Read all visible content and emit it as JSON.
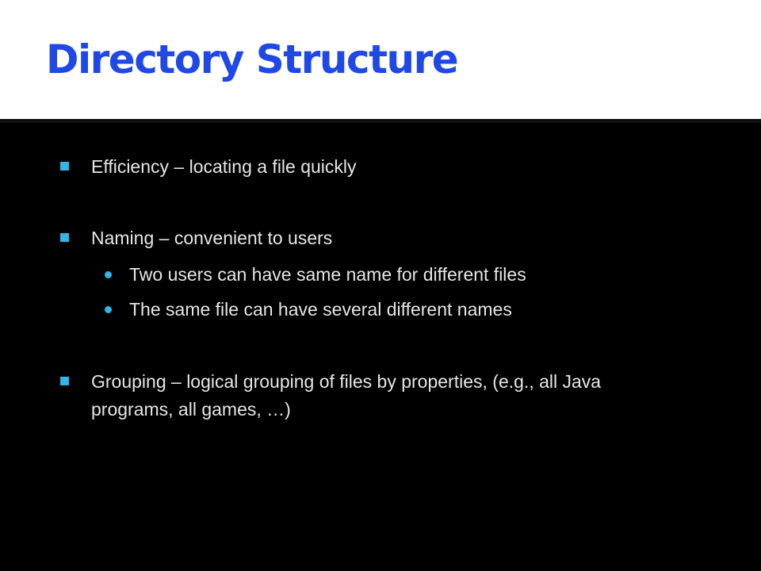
{
  "slide": {
    "title": "Directory Structure",
    "bullets": [
      {
        "text": "Efficiency – locating a file quickly",
        "subitems": []
      },
      {
        "text": "Naming – convenient to users",
        "subitems": [
          "Two users can have same name for different files",
          "The same file can have several different names"
        ]
      },
      {
        "text_line1": "Grouping – logical grouping of files by properties, (e.g., all Java",
        "text_line2": "programs, all games, …)"
      }
    ]
  },
  "colors": {
    "title": "#1f48e6",
    "background": "#000000",
    "text": "#e6e6e6",
    "bullet_marker": "#33b5e5"
  },
  "icons": {
    "level1_marker": "square-bullet-icon",
    "level2_marker": "round-bullet-icon"
  }
}
